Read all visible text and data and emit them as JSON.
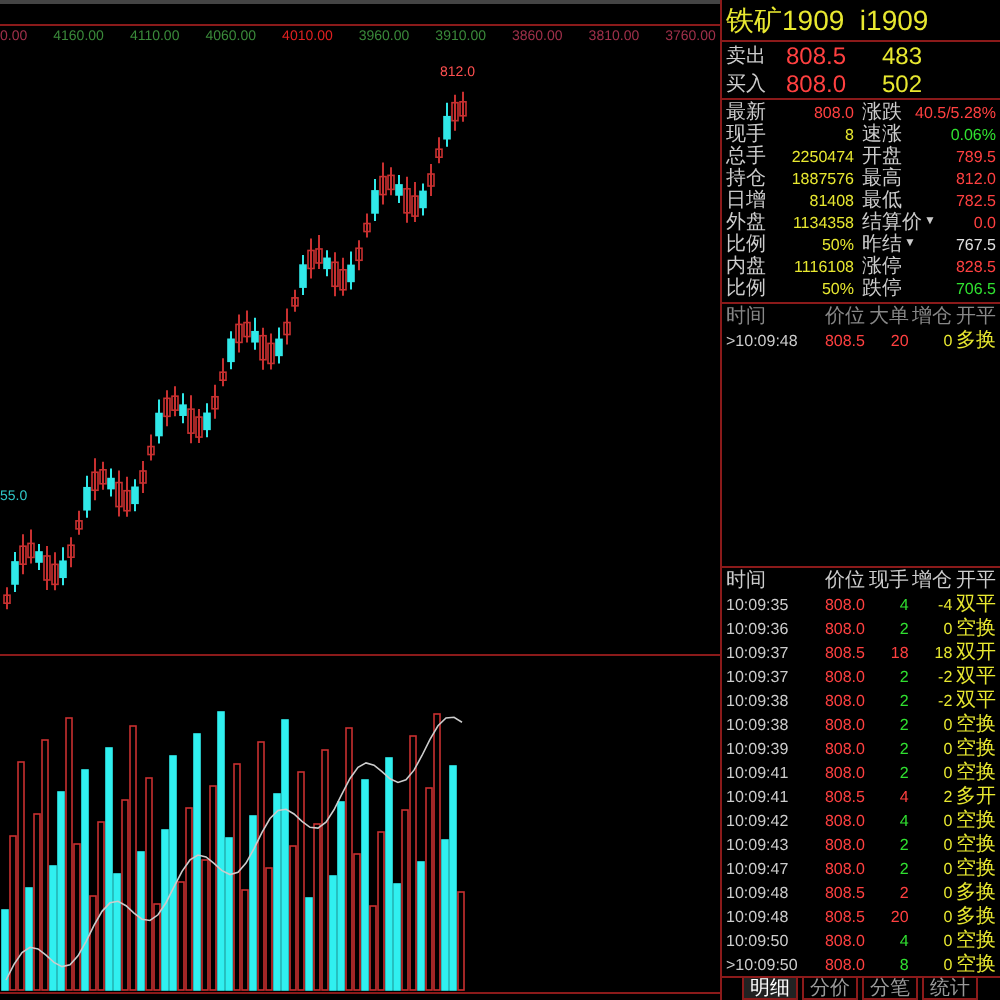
{
  "top_axis": [
    {
      "label": "0.00",
      "color": "#a0304a"
    },
    {
      "label": "4160.00",
      "color": "#3a8a3a"
    },
    {
      "label": "4110.00",
      "color": "#3a8a3a"
    },
    {
      "label": "4060.00",
      "color": "#3a8a3a"
    },
    {
      "label": "4010.00",
      "color": "#e02020"
    },
    {
      "label": "3960.00",
      "color": "#3a8a3a"
    },
    {
      "label": "3910.00",
      "color": "#3a8a3a"
    },
    {
      "label": "3860.00",
      "color": "#a0304a"
    },
    {
      "label": "3810.00",
      "color": "#a0304a"
    },
    {
      "label": "3760.00",
      "color": "#a0304a"
    }
  ],
  "chart_high_label": "812.0",
  "chart_low_label": "55.0",
  "quote": {
    "title": "铁矿1909  i1909",
    "sell": {
      "label": "卖出",
      "price": "808.5",
      "volume": "483"
    },
    "buy": {
      "label": "买入",
      "price": "808.0",
      "volume": "502"
    }
  },
  "stats_left": [
    {
      "label": "最新",
      "value": "808.0",
      "color": "#ff4040"
    },
    {
      "label": "现手",
      "value": "8",
      "color": "#e8e830"
    },
    {
      "label": "总手",
      "value": "2250474",
      "color": "#e8e830"
    },
    {
      "label": "持仓",
      "value": "1887576",
      "color": "#e8e830"
    },
    {
      "label": "日增",
      "value": "81408",
      "color": "#e8e830"
    },
    {
      "label": "外盘",
      "value": "1134358",
      "color": "#e8e830"
    },
    {
      "label": "比例",
      "value": "50%",
      "color": "#e8e830"
    },
    {
      "label": "内盘",
      "value": "1116108",
      "color": "#e8e830"
    },
    {
      "label": "比例",
      "value": "50%",
      "color": "#e8e830"
    }
  ],
  "stats_right": [
    {
      "label": "涨跌",
      "value": "40.5/5.28%",
      "color": "#ff4040"
    },
    {
      "label": "速涨",
      "value": "0.06%",
      "color": "#30e030"
    },
    {
      "label": "开盘",
      "value": "789.5",
      "color": "#ff4040"
    },
    {
      "label": "最高",
      "value": "812.0",
      "color": "#ff4040"
    },
    {
      "label": "最低",
      "value": "782.5",
      "color": "#ff4040"
    },
    {
      "label": "结算价",
      "arrow": "▼",
      "value": "0.0",
      "color": "#ff4040"
    },
    {
      "label": "昨结",
      "arrow": "▼",
      "value": "767.5",
      "color": "#e0e0e0"
    },
    {
      "label": "涨停",
      "value": "828.5",
      "color": "#ff4040"
    },
    {
      "label": "跌停",
      "value": "706.5",
      "color": "#30e030"
    }
  ],
  "big_orders": {
    "columns": [
      "时间",
      "价位",
      "大单",
      "增仓",
      "开平"
    ],
    "rows": [
      {
        "time": ">10:09:48",
        "price": "808.5",
        "qty": "20",
        "change": "0",
        "type": "多换",
        "color": "#ff4040"
      }
    ]
  },
  "trades": {
    "columns": [
      "时间",
      "价位",
      "现手",
      "增仓",
      "开平"
    ],
    "rows": [
      {
        "time": "10:09:35",
        "price": "808.0",
        "qty": "4",
        "change": "-4",
        "type": "双平",
        "color": "#30e030"
      },
      {
        "time": "10:09:36",
        "price": "808.0",
        "qty": "2",
        "change": "0",
        "type": "空换",
        "color": "#30e030"
      },
      {
        "time": "10:09:37",
        "price": "808.5",
        "qty": "18",
        "change": "18",
        "type": "双开",
        "color": "#ff4040"
      },
      {
        "time": "10:09:37",
        "price": "808.0",
        "qty": "2",
        "change": "-2",
        "type": "双平",
        "color": "#30e030"
      },
      {
        "time": "10:09:38",
        "price": "808.0",
        "qty": "2",
        "change": "-2",
        "type": "双平",
        "color": "#30e030"
      },
      {
        "time": "10:09:38",
        "price": "808.0",
        "qty": "2",
        "change": "0",
        "type": "空换",
        "color": "#30e030"
      },
      {
        "time": "10:09:39",
        "price": "808.0",
        "qty": "2",
        "change": "0",
        "type": "空换",
        "color": "#30e030"
      },
      {
        "time": "10:09:41",
        "price": "808.0",
        "qty": "2",
        "change": "0",
        "type": "空换",
        "color": "#30e030"
      },
      {
        "time": "10:09:41",
        "price": "808.5",
        "qty": "4",
        "change": "2",
        "type": "多开",
        "color": "#ff4040"
      },
      {
        "time": "10:09:42",
        "price": "808.0",
        "qty": "4",
        "change": "0",
        "type": "空换",
        "color": "#30e030"
      },
      {
        "time": "10:09:43",
        "price": "808.0",
        "qty": "2",
        "change": "0",
        "type": "空换",
        "color": "#30e030"
      },
      {
        "time": "10:09:47",
        "price": "808.0",
        "qty": "2",
        "change": "0",
        "type": "空换",
        "color": "#30e030"
      },
      {
        "time": "10:09:48",
        "price": "808.5",
        "qty": "2",
        "change": "0",
        "type": "多换",
        "color": "#ff4040"
      },
      {
        "time": "10:09:48",
        "price": "808.5",
        "qty": "20",
        "change": "0",
        "type": "多换",
        "color": "#ff4040"
      },
      {
        "time": "10:09:50",
        "price": "808.0",
        "qty": "4",
        "change": "0",
        "type": "空换",
        "color": "#30e030"
      },
      {
        "time": ">10:09:50",
        "price": "808.0",
        "qty": "8",
        "change": "0",
        "type": "空换",
        "color": "#30e030"
      }
    ]
  },
  "bottom_tabs": [
    {
      "label": "明细",
      "selected": true
    },
    {
      "label": "分价",
      "selected": false
    },
    {
      "label": "分笔",
      "selected": false
    },
    {
      "label": "统计",
      "selected": false
    }
  ]
}
